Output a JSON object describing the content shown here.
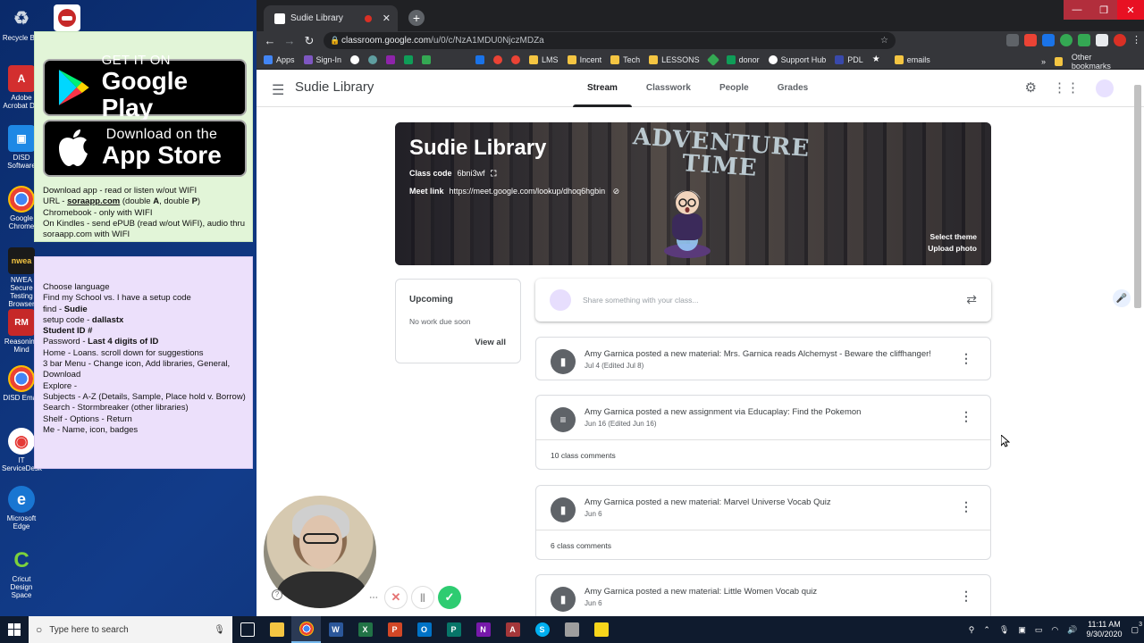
{
  "desktop": {
    "icons": [
      {
        "label": "Recycle Bin",
        "color": "#9fb7d8",
        "glyph": "♻"
      },
      {
        "label": "Adobe Acrobat DC",
        "color": "#d32f2f",
        "glyph": "A"
      },
      {
        "label": "DISD Software",
        "color": "#1e88e5",
        "glyph": "▣"
      },
      {
        "label": "Google Chrome",
        "color": "#fbbc04",
        "glyph": "●"
      },
      {
        "label": "NWEA Secure Testing Browser",
        "color": "#1a1a1a",
        "glyph": "N"
      },
      {
        "label": "Reasoning Mind",
        "color": "#c62828",
        "glyph": "RM"
      },
      {
        "label": "DISD Email",
        "color": "#34a853",
        "glyph": "●"
      },
      {
        "label": "IT ServiceDesk",
        "color": "#e53935",
        "glyph": "◉"
      },
      {
        "label": "Microsoft Edge",
        "color": "#1976d2",
        "glyph": "e"
      },
      {
        "label": "Cricut Design Space",
        "color": "#43a047",
        "glyph": "C"
      }
    ]
  },
  "sticky_green": {
    "google_play": {
      "small": "GET IT ON",
      "big": "Google Play"
    },
    "app_store": {
      "small": "Download on the",
      "big": "App Store"
    },
    "lines": {
      "l1": "Download app - read or listen w/out WIFI",
      "l2a": "URL - ",
      "l2b": "soraapp.com",
      "l2c": "  (double ",
      "l2d": "A",
      "l2e": ", double ",
      "l2f": "P",
      "l2g": ")",
      "l3": "Chromebook - only with WIFI",
      "l4": "On Kindles - send ePUB (read w/out WiFI), audio thru soraapp.com with WIFI"
    }
  },
  "sticky_purple": {
    "l1": "Choose language",
    "l2": "Find my School vs. I have a setup code",
    "l3a": "find - ",
    "l3b": "Sudie",
    "l4a": "setup code - ",
    "l4b": "dallastx",
    "l5": "Student ID #",
    "l6a": "Password - ",
    "l6b": "Last 4 digits of ID",
    "l7": "Home - Loans. scroll down for suggestions",
    "l8": "3 bar Menu - Change icon, Add libraries, General, Download",
    "l9": "Explore -",
    "l10": "Subjects - A-Z (Details, Sample, Place hold v. Borrow)",
    "l11": "Search - Stormbreaker (other libraries)",
    "l12": "Shelf - Options - Return",
    "l13": "Me - Name, icon, badges"
  },
  "browser": {
    "tab_title": "Sudie Library",
    "url_host": "classroom.google.com",
    "url_path": "/u/0/c/NzA1MDU0NjczMDZa",
    "bookmarks": [
      {
        "label": "Apps",
        "color": "#4285f4"
      },
      {
        "label": "Sign-In",
        "color": "#7e57c2"
      },
      {
        "label": "",
        "color": "#ffffff"
      },
      {
        "label": "",
        "color": "#5f9ea0"
      },
      {
        "label": "",
        "color": "#8e24aa"
      },
      {
        "label": "",
        "color": "#0f9d58"
      },
      {
        "label": "",
        "color": "#34a853"
      },
      {
        "label": "",
        "color": "#1a73e8"
      },
      {
        "label": "",
        "color": "#ea4335"
      },
      {
        "label": "",
        "color": "#ea4335"
      },
      {
        "label": "LMS",
        "color": "#f4c542"
      },
      {
        "label": "Incent",
        "color": "#f4c542"
      },
      {
        "label": "Tech",
        "color": "#f4c542"
      },
      {
        "label": "LESSONS",
        "color": "#f4c542"
      },
      {
        "label": "",
        "color": "#34a853"
      },
      {
        "label": "donor",
        "color": "#0f9d58"
      },
      {
        "label": "Support Hub",
        "color": "#ffffff"
      },
      {
        "label": "PDL",
        "color": "#3949ab"
      },
      {
        "label": "",
        "color": "#ffffff"
      },
      {
        "label": "emails",
        "color": "#f4c542"
      }
    ],
    "other_bookmarks": "Other bookmarks"
  },
  "classroom": {
    "title": "Sudie Library",
    "tabs": [
      "Stream",
      "Classwork",
      "People",
      "Grades"
    ],
    "banner": {
      "title": "Sudie Library",
      "class_code_label": "Class code",
      "class_code": "6bni3wf",
      "meet_link_label": "Meet link",
      "meet_link": "https://meet.google.com/lookup/dhoq6hgbin",
      "theme_art_line1": "ADVENTURE",
      "theme_art_line2": "TIME",
      "select_theme": "Select theme",
      "upload_photo": "Upload photo"
    },
    "upcoming": {
      "heading": "Upcoming",
      "empty": "No work due soon",
      "view_all": "View all"
    },
    "share_placeholder": "Share something with your class...",
    "posts": [
      {
        "text": "Amy Garnica posted a new material: Mrs. Garnica reads Alchemyst - Beware the cliffhanger!",
        "date": "Jul 4 (Edited Jul 8)",
        "comments": "",
        "icon": "material"
      },
      {
        "text": "Amy Garnica posted a new assignment via Educaplay: Find the Pokemon",
        "date": "Jun 16 (Edited Jun 16)",
        "comments": "10 class comments",
        "icon": "assignment"
      },
      {
        "text": "Amy Garnica posted a new material: Marvel Universe Vocab Quiz",
        "date": "Jun 6",
        "comments": "6 class comments",
        "icon": "material"
      },
      {
        "text": "Amy Garnica posted a new material: Little Women Vocab quiz",
        "date": "Jun 6",
        "comments": "",
        "icon": "material"
      }
    ]
  },
  "taskbar": {
    "search_placeholder": "Type here to search",
    "time": "11:11 AM",
    "date": "9/30/2020",
    "notification_count": "3"
  }
}
